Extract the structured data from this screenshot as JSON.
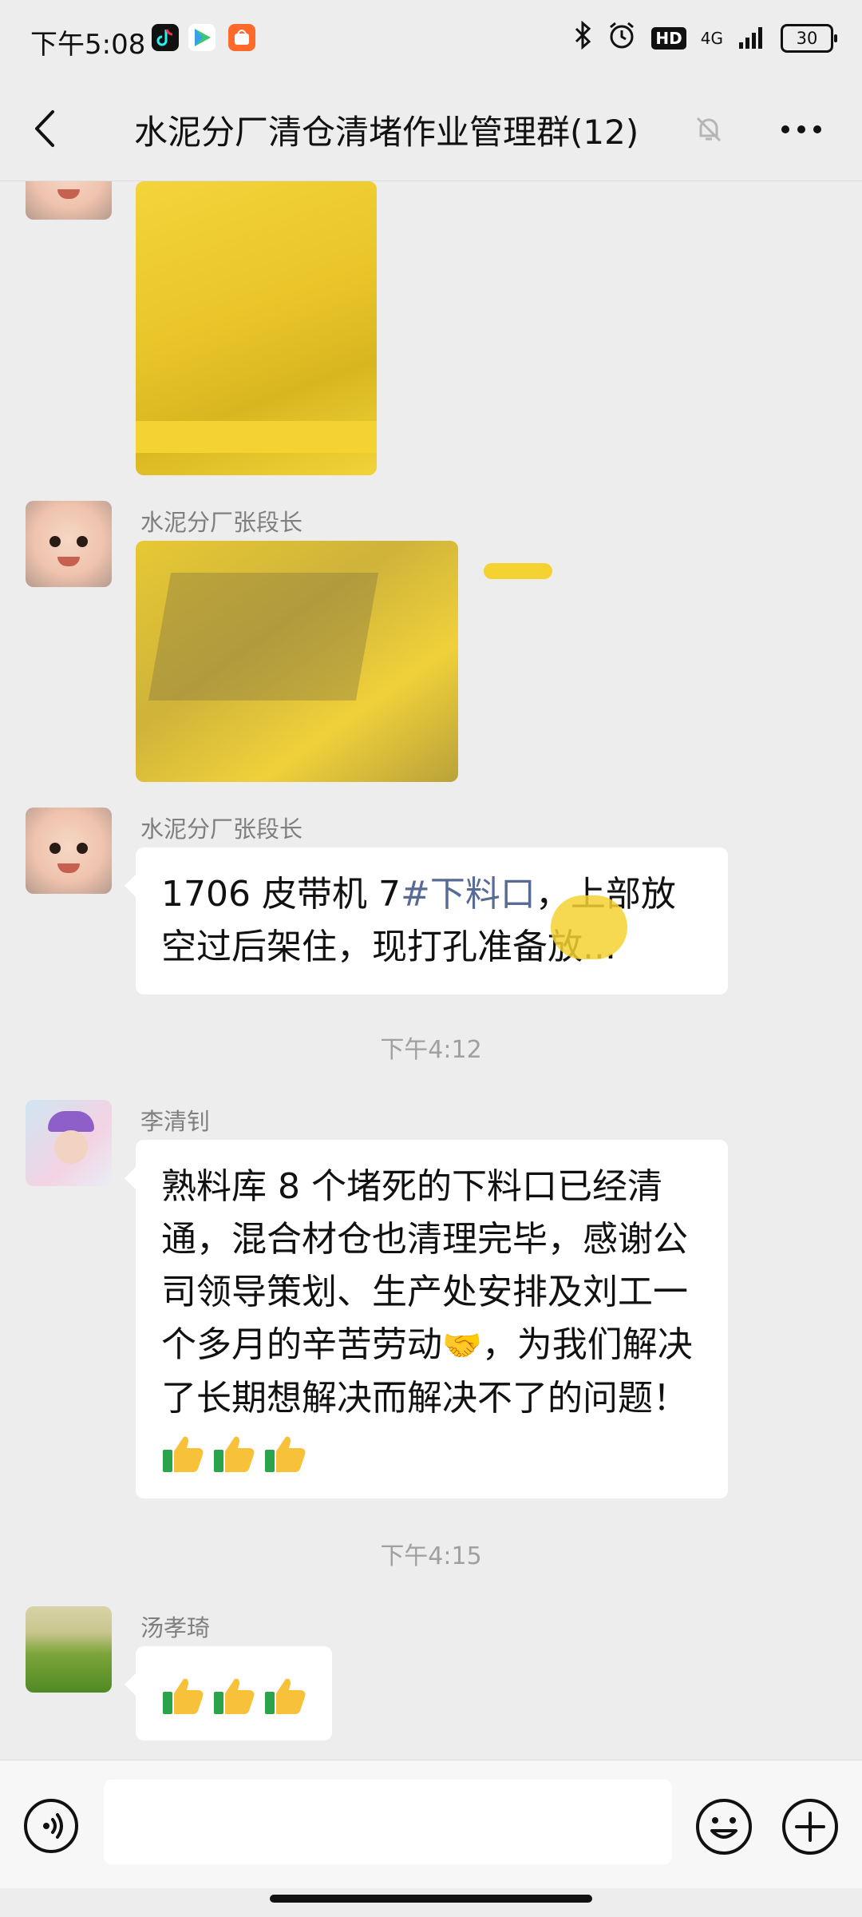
{
  "status_bar": {
    "time": "下午5:08",
    "network": "4G",
    "battery": "30",
    "hd_label": "HD"
  },
  "header": {
    "title": "水泥分厂清仓清堵作业管理群(12)"
  },
  "messages": [
    {
      "type": "image",
      "sender": "",
      "avatar": "baby"
    },
    {
      "type": "image",
      "sender": "水泥分厂张段长",
      "avatar": "baby"
    },
    {
      "type": "text",
      "sender": "水泥分厂张段长",
      "avatar": "baby",
      "text_before": "1706 皮带机 7",
      "hashtag": "#下料口",
      "text_after": "，上部放空过后架住，现打孔准备放..."
    },
    {
      "type": "timestamp",
      "text": "下午4:12"
    },
    {
      "type": "text",
      "sender": "李清钊",
      "avatar": "li",
      "text_before": "熟料库 8 个堵死的下料口已经清通，混合材仓也清理完毕，感谢公司领导策划、生产处安排及刘工一个多月的辛苦劳动",
      "emoji_handshake": "🤝",
      "text_after": "，为我们解决了长期想解决而解决不了的问题！",
      "thumbs": 3
    },
    {
      "type": "timestamp",
      "text": "下午4:15"
    },
    {
      "type": "text",
      "sender": "汤孝琦",
      "avatar": "field",
      "thumbs": 3
    }
  ],
  "input": {
    "placeholder": ""
  },
  "icons": {
    "back": "back-arrow-icon",
    "mute": "bell-muted-icon",
    "more": "more-dots-icon",
    "voice": "voice-icon",
    "emoji": "emoji-icon",
    "plus": "plus-icon",
    "thumbs": "thumbs-up-icon"
  },
  "colors": {
    "background": "#ededed",
    "hashtag": "#576b95",
    "timestamp": "#a0a0a0",
    "sender": "#7f7f7f",
    "redaction": "#f4d231"
  }
}
